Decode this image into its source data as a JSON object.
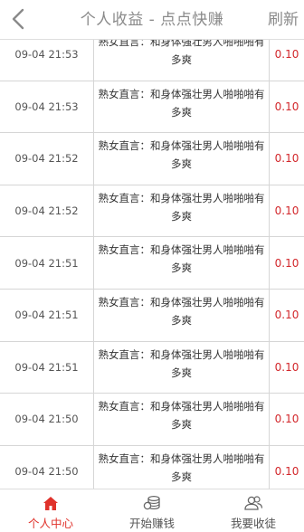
{
  "header": {
    "title": "个人收益 - 点点快赚",
    "refresh_label": "刷新"
  },
  "records": [
    {
      "time": "09-04 21:53",
      "title": "熟女直言：和身体强壮男人啪啪啪有多爽",
      "amount": "0.10"
    },
    {
      "time": "09-04 21:53",
      "title": "熟女直言：和身体强壮男人啪啪啪有多爽",
      "amount": "0.10"
    },
    {
      "time": "09-04 21:52",
      "title": "熟女直言：和身体强壮男人啪啪啪有多爽",
      "amount": "0.10"
    },
    {
      "time": "09-04 21:52",
      "title": "熟女直言：和身体强壮男人啪啪啪有多爽",
      "amount": "0.10"
    },
    {
      "time": "09-04 21:51",
      "title": "熟女直言：和身体强壮男人啪啪啪有多爽",
      "amount": "0.10"
    },
    {
      "time": "09-04 21:51",
      "title": "熟女直言：和身体强壮男人啪啪啪有多爽",
      "amount": "0.10"
    },
    {
      "time": "09-04 21:51",
      "title": "熟女直言：和身体强壮男人啪啪啪有多爽",
      "amount": "0.10"
    },
    {
      "time": "09-04 21:50",
      "title": "熟女直言：和身体强壮男人啪啪啪有多爽",
      "amount": "0.10"
    },
    {
      "time": "09-04 21:50",
      "title": "熟女直言：和身体强壮男人啪啪啪有多爽",
      "amount": "0.10"
    }
  ],
  "tabbar": {
    "items": [
      {
        "label": "个人中心",
        "icon": "home-icon",
        "active": true
      },
      {
        "label": "开始赚钱",
        "icon": "coins-icon",
        "active": false
      },
      {
        "label": "我要收徒",
        "icon": "users-icon",
        "active": false
      }
    ]
  },
  "colors": {
    "accent": "#e0322b",
    "amount": "#d2272b",
    "header_text": "#8a8a8a"
  }
}
